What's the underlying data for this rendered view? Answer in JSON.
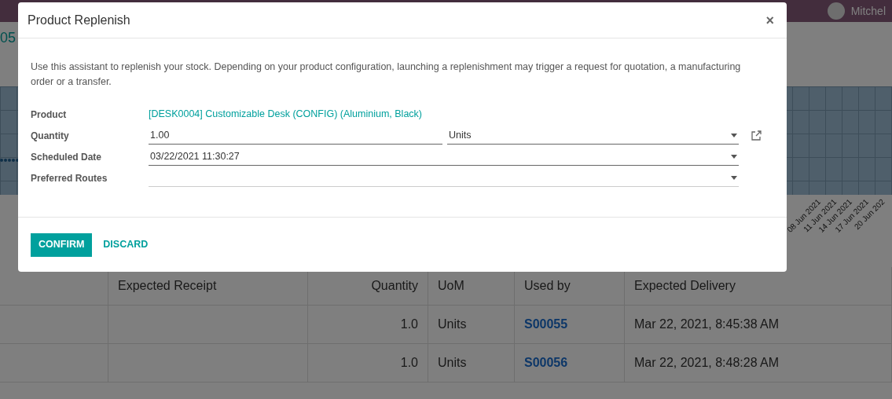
{
  "top_bar": {
    "user_name": "Mitchel"
  },
  "page_title_fragment": "05",
  "chart": {
    "tick_labels": [
      "08 Jun 2021",
      "11 Jun 2021",
      "14 Jun 2021",
      "17 Jun 2021",
      "20 Jun 202"
    ]
  },
  "table": {
    "columns": [
      "",
      "Expected Receipt",
      "Quantity",
      "UoM",
      "Used by",
      "Expected Delivery"
    ],
    "rows": [
      [
        "",
        "",
        "1.0",
        "Units",
        "S00055",
        "Mar 22, 2021, 8:45:38 AM"
      ],
      [
        "",
        "",
        "1.0",
        "Units",
        "S00056",
        "Mar 22, 2021, 8:48:28 AM"
      ]
    ]
  },
  "dialog": {
    "title": "Product Replenish",
    "close": "×",
    "intro": "Use this assistant to replenish your stock. Depending on your product configuration, launching a replenishment may trigger a request for quotation, a manufacturing order or a transfer.",
    "fields": [
      {
        "kind": "link",
        "label": "Product",
        "value": "[DESK0004] Customizable Desk (CONFIG) (Aluminium, Black)"
      },
      {
        "kind": "quantity",
        "label": "Quantity",
        "value": "1.00",
        "unit": "Units"
      },
      {
        "kind": "select",
        "label": "Scheduled Date",
        "value": "03/22/2021 11:30:27"
      },
      {
        "kind": "select",
        "label": "Preferred Routes"
      }
    ],
    "buttons": [
      {
        "label": "CONFIRM",
        "primary": true
      },
      {
        "label": "DISCARD",
        "primary": false
      }
    ]
  }
}
